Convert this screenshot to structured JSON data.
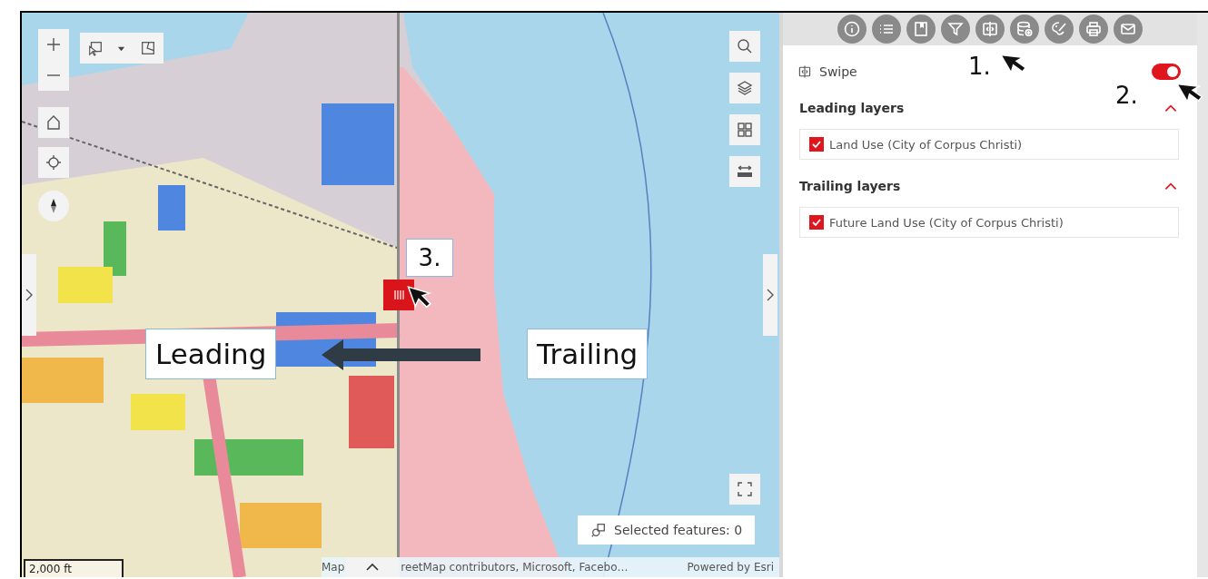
{
  "map": {
    "scale": "2,000 ft",
    "selected_features": "Selected features: 0",
    "attribution_start": "Map",
    "attribution_end": "reetMap contributors, Microsoft, Facebo…",
    "powered_by": "Powered by Esri"
  },
  "annotations": {
    "step_1": "1.",
    "step_2": "2.",
    "step_3": "3.",
    "leading_label": "Leading",
    "trailing_label": "Trailing"
  },
  "swipe": {
    "title": "Swipe",
    "on": true
  },
  "sections": [
    {
      "title": "Leading layers",
      "expanded": true,
      "layers": [
        {
          "label": "Land Use (City of Corpus Christi)",
          "checked": true
        }
      ]
    },
    {
      "title": "Trailing layers",
      "expanded": true,
      "layers": [
        {
          "label": "Future Land Use (City of Corpus Christi)",
          "checked": true
        }
      ]
    }
  ]
}
